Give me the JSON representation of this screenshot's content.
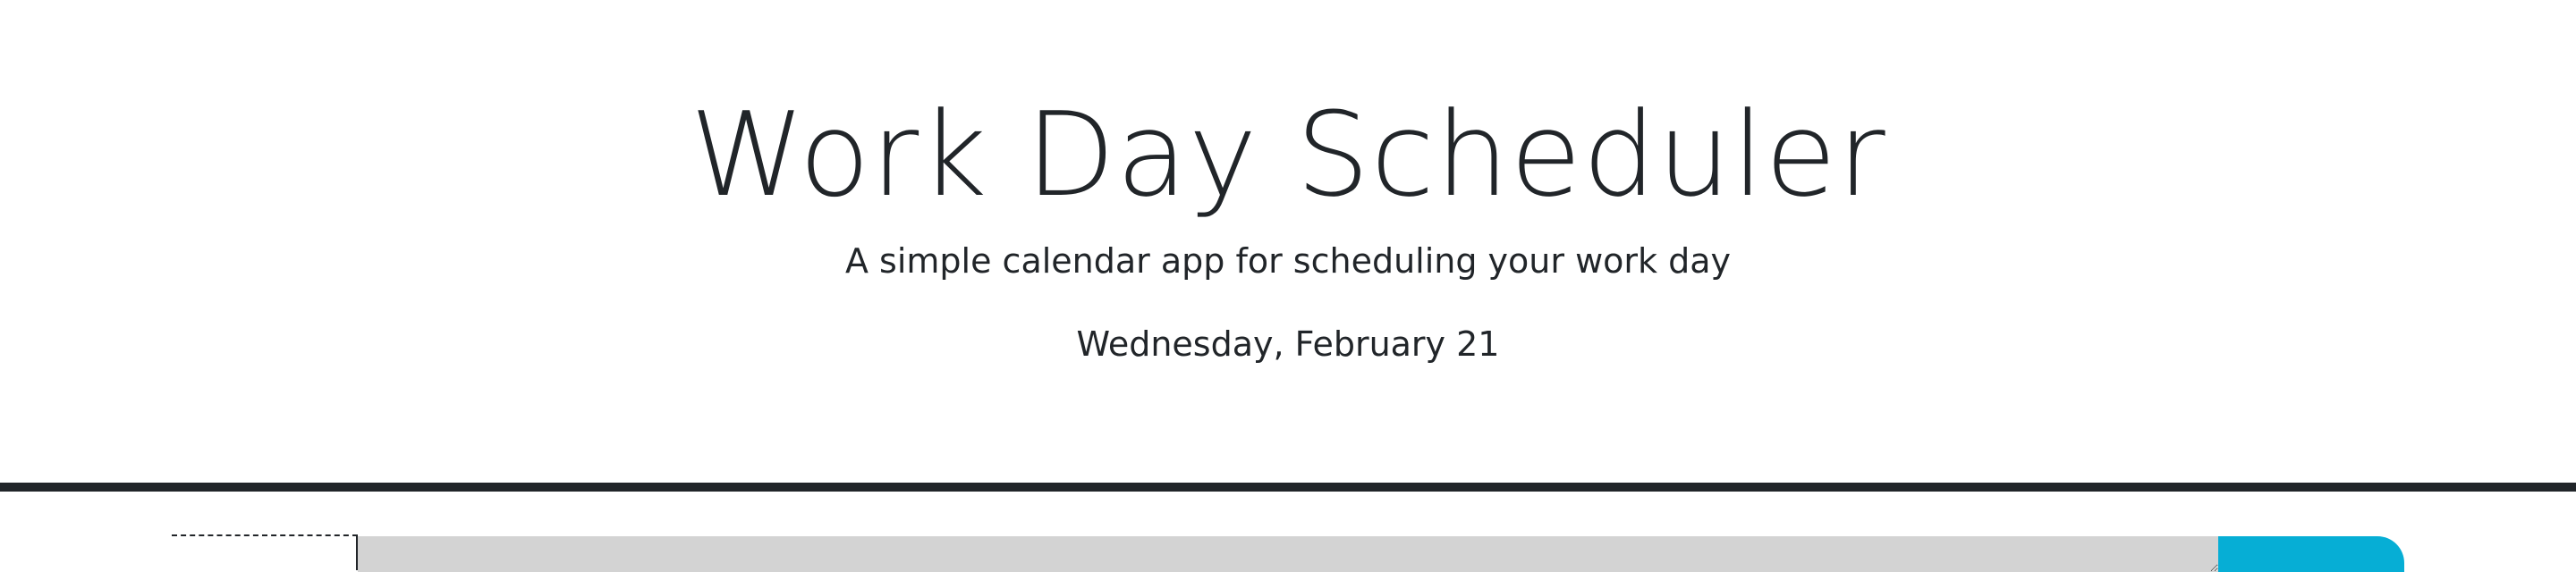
{
  "header": {
    "title": "Work Day Scheduler",
    "subtitle": "A simple calendar app for scheduling your work day",
    "current_day": "Wednesday, February 21"
  },
  "time_block": {
    "hour": "",
    "description": ""
  },
  "colors": {
    "text": "#212529",
    "divider": "#212529",
    "past_block": "#d3d3d3",
    "save_button": "#06aed5"
  }
}
